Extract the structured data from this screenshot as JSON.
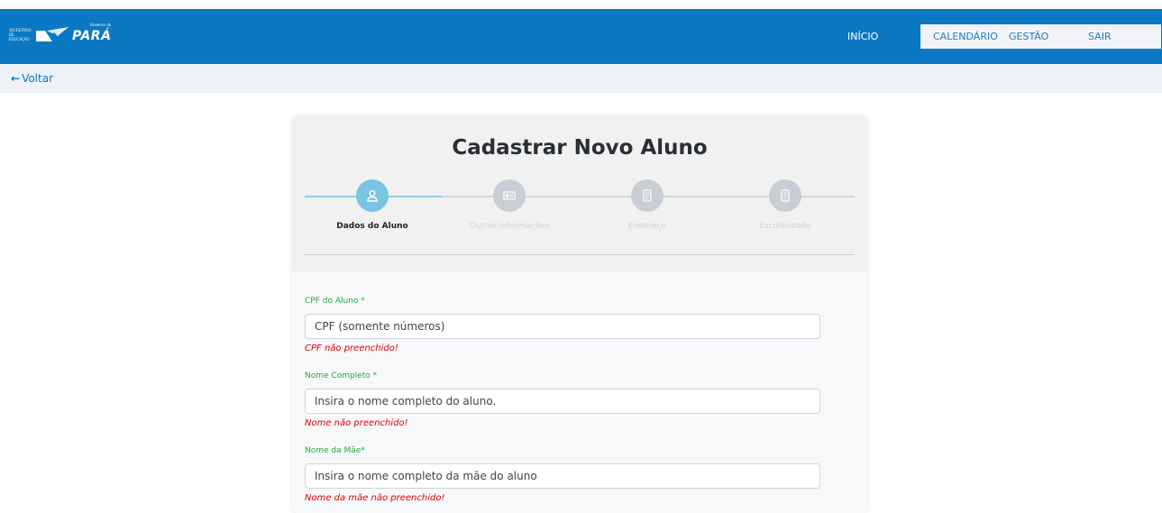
{
  "brand": {
    "secretaria_line1": "Secretaria de",
    "secretaria_line2": "Educação",
    "gov_small": "Governo do",
    "gov_big": "PARÁ"
  },
  "nav": {
    "inicio": "INÍCIO",
    "calendario": "CALENDÁRIO",
    "gestao": "GESTÃO",
    "sair": "SAIR"
  },
  "subbar": {
    "back_arrow": "←",
    "back_label": "Voltar"
  },
  "form": {
    "title": "Cadastrar Novo Aluno",
    "steps": [
      {
        "label": "Dados do Aluno",
        "icon": "user-icon",
        "active": true
      },
      {
        "label": "Outras Informações",
        "icon": "id-card-icon",
        "active": false
      },
      {
        "label": "Endereço",
        "icon": "document-icon",
        "active": false
      },
      {
        "label": "Escolaridade",
        "icon": "document-icon",
        "active": false
      }
    ],
    "fields": [
      {
        "label": "CPF do Aluno *",
        "placeholder": "CPF (somente números)",
        "error": "CPF não preenchido!"
      },
      {
        "label": "Nome Completo *",
        "placeholder": "Insira o nome completo do aluno.",
        "error": "Nome não preenchido!"
      },
      {
        "label": "Nome da Mãe*",
        "placeholder": "Insira o nome completo da mãe do aluno",
        "error": "Nome da mãe não preenchido!"
      }
    ]
  },
  "colors": {
    "navbar": "#0a78c2",
    "subbar": "#eef1f6",
    "step_active": "#78c5e3",
    "step_inactive": "#c9ced5",
    "label_green": "#28a745",
    "error_red": "#e00000"
  }
}
